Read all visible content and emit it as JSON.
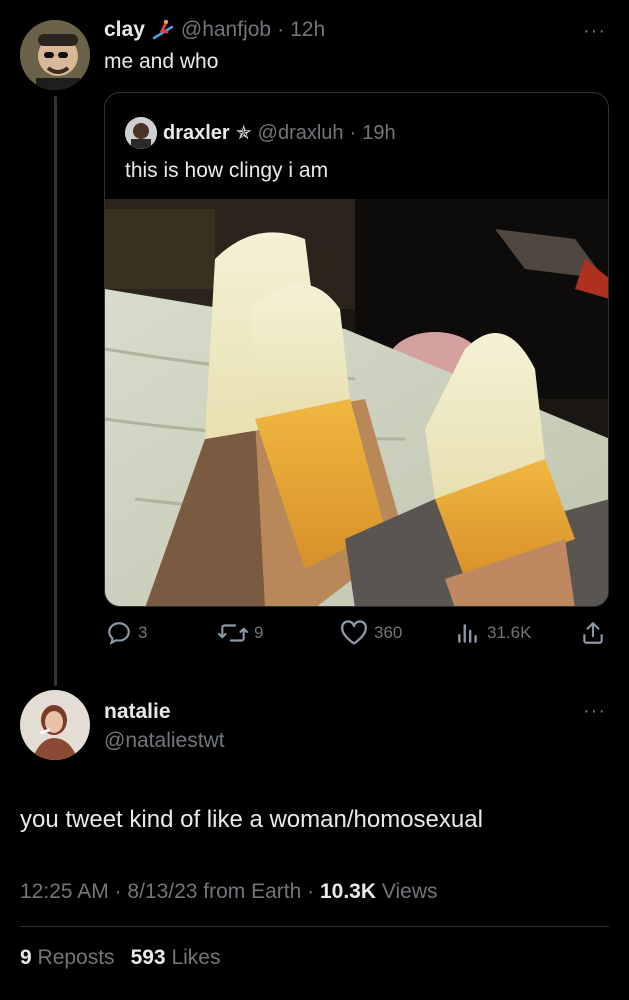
{
  "tweet": {
    "display_name": "clay",
    "handle": "@hanfjob",
    "separator": "·",
    "time": "12h",
    "text": "me and who",
    "badge_icon": "skiing-person-icon"
  },
  "quoted_tweet": {
    "display_name": "draxler",
    "badge": "✯",
    "handle": "@draxluh",
    "separator": "·",
    "time": "19h",
    "text": "this is how clingy i am"
  },
  "actions": {
    "replies": "3",
    "reposts": "9",
    "likes": "360",
    "views": "31.6K"
  },
  "reply": {
    "display_name": "natalie",
    "handle": "@nataliestwt",
    "text": "you tweet kind of like a woman/homosexual",
    "timestamp": "12:25 AM · 8/13/23 from Earth · ",
    "views_count": "10.3K",
    "views_label": " Views",
    "reposts_count": "9",
    "reposts_label": " Reposts",
    "likes_count": "593",
    "likes_label": " Likes"
  },
  "colors": {
    "background": "#000000",
    "text": "#e7e9ea",
    "muted": "#71767b",
    "border": "#2f3336"
  }
}
